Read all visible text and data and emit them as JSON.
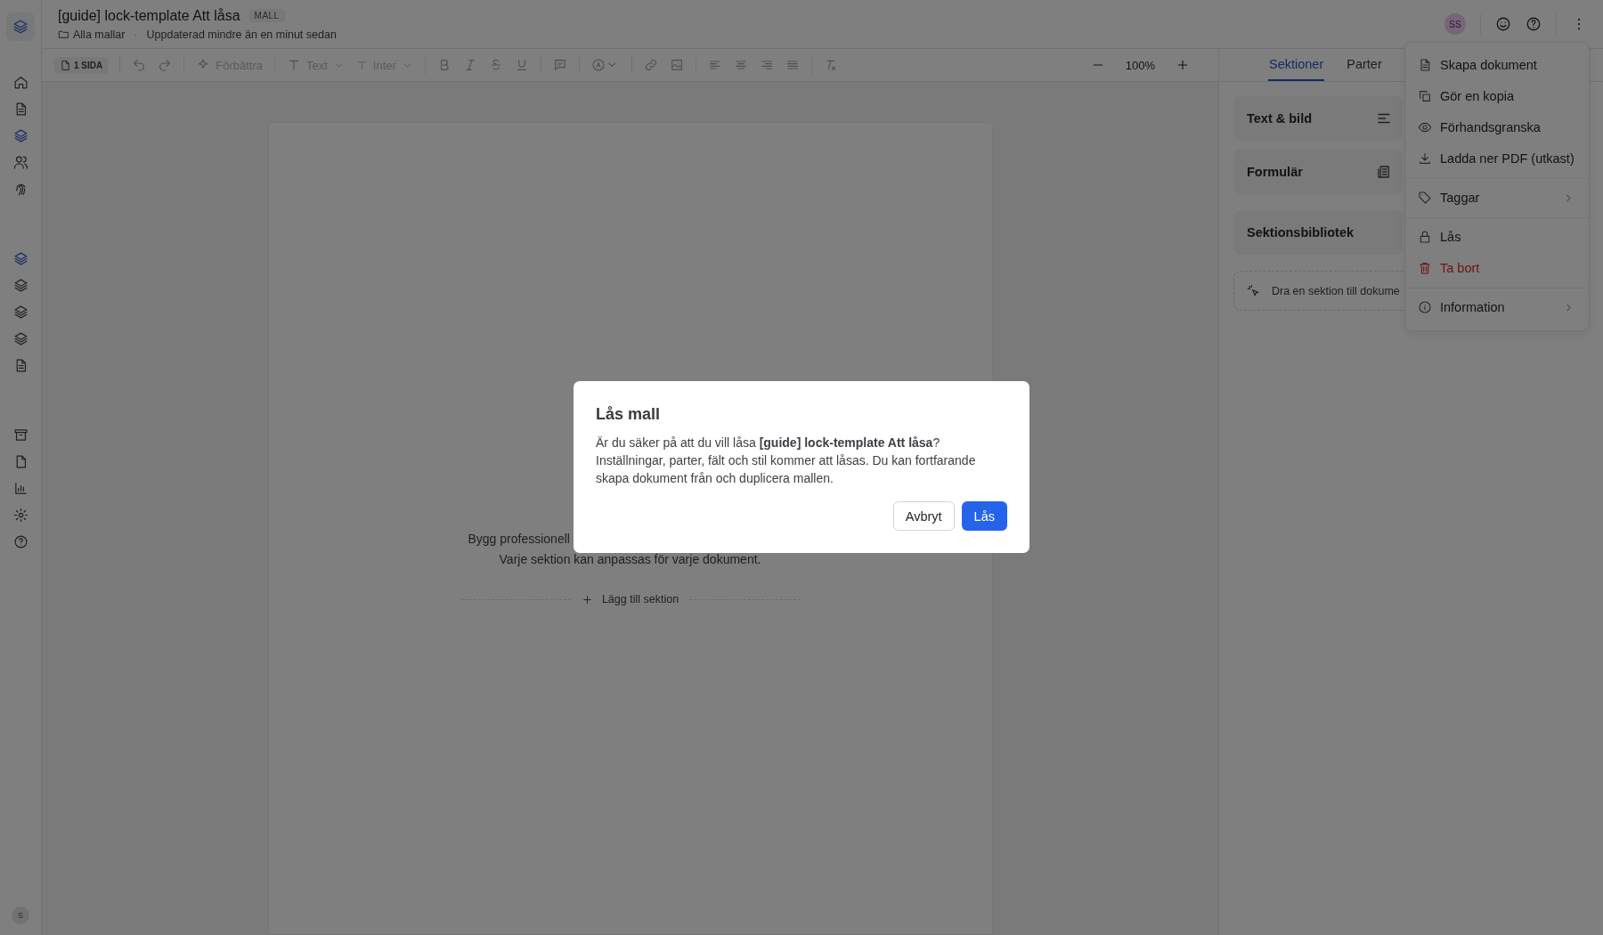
{
  "sidebar": {
    "groups": [
      [
        {
          "selected": false
        },
        {
          "selected": false
        },
        {
          "selected": true
        },
        {
          "selected": false
        },
        {
          "selected": false
        }
      ],
      [
        {
          "selected": true
        },
        {
          "selected": false
        },
        {
          "selected": false
        },
        {
          "selected": false
        },
        {
          "selected": false
        }
      ],
      [
        {
          "selected": false
        },
        {
          "selected": false
        },
        {
          "selected": false
        },
        {
          "selected": false
        },
        {
          "selected": false
        }
      ]
    ],
    "user_avatar": "S"
  },
  "header": {
    "title": "[guide] lock-template Att låsa",
    "badge": "MALL",
    "breadcrumb": "Alla mallar",
    "separator": "·",
    "updated": "Uppdaterad mindre än en minut sedan",
    "avatar": "SS"
  },
  "toolbar": {
    "page_count": "1 SIDA",
    "improve": {
      "label": "Förbättra",
      "disabled": true
    },
    "text_style": {
      "label": "Text",
      "disabled": true
    },
    "font": {
      "label": "Inter",
      "disabled": true
    },
    "zoom": "100%"
  },
  "page": {
    "intro_lines": [
      "Bygg professionell",
      "Varje sektion kan anpassas för varje dokument."
    ],
    "add_section": "Lägg till sektion"
  },
  "panel": {
    "tabs": [
      {
        "label": "Sektioner",
        "selected": true
      },
      {
        "label": "Parter",
        "selected": false
      }
    ],
    "cards": [
      "Text & bild",
      "Formulär",
      "Sektionsbibliotek"
    ],
    "drop_hint": "Dra en sektion till dokume"
  },
  "menu": {
    "groups": [
      [
        {
          "label": "Skapa dokument",
          "danger": false,
          "submenu": false
        },
        {
          "label": "Gör en kopia",
          "danger": false,
          "submenu": false
        },
        {
          "label": "Förhandsgranska",
          "danger": false,
          "submenu": false
        },
        {
          "label": "Ladda ner PDF (utkast)",
          "danger": false,
          "submenu": false
        }
      ],
      [
        {
          "label": "Taggar",
          "danger": false,
          "submenu": true
        }
      ],
      [
        {
          "label": "Lås",
          "danger": false,
          "submenu": false
        },
        {
          "label": "Ta bort",
          "danger": true,
          "submenu": false
        }
      ],
      [
        {
          "label": "Information",
          "danger": false,
          "submenu": true
        }
      ]
    ]
  },
  "dialog": {
    "title": "Lås mall",
    "body": "Är du säker på att du vill låsa **[guide] lock-template Att låsa**? Inställningar, parter, fält och stil kommer att låsas. Du kan fortfarande skapa dokument från och duplicera mallen.",
    "buttons": [
      {
        "label": "Avbryt",
        "kind": "secondary"
      },
      {
        "label": "Lås",
        "kind": "primary"
      }
    ]
  }
}
